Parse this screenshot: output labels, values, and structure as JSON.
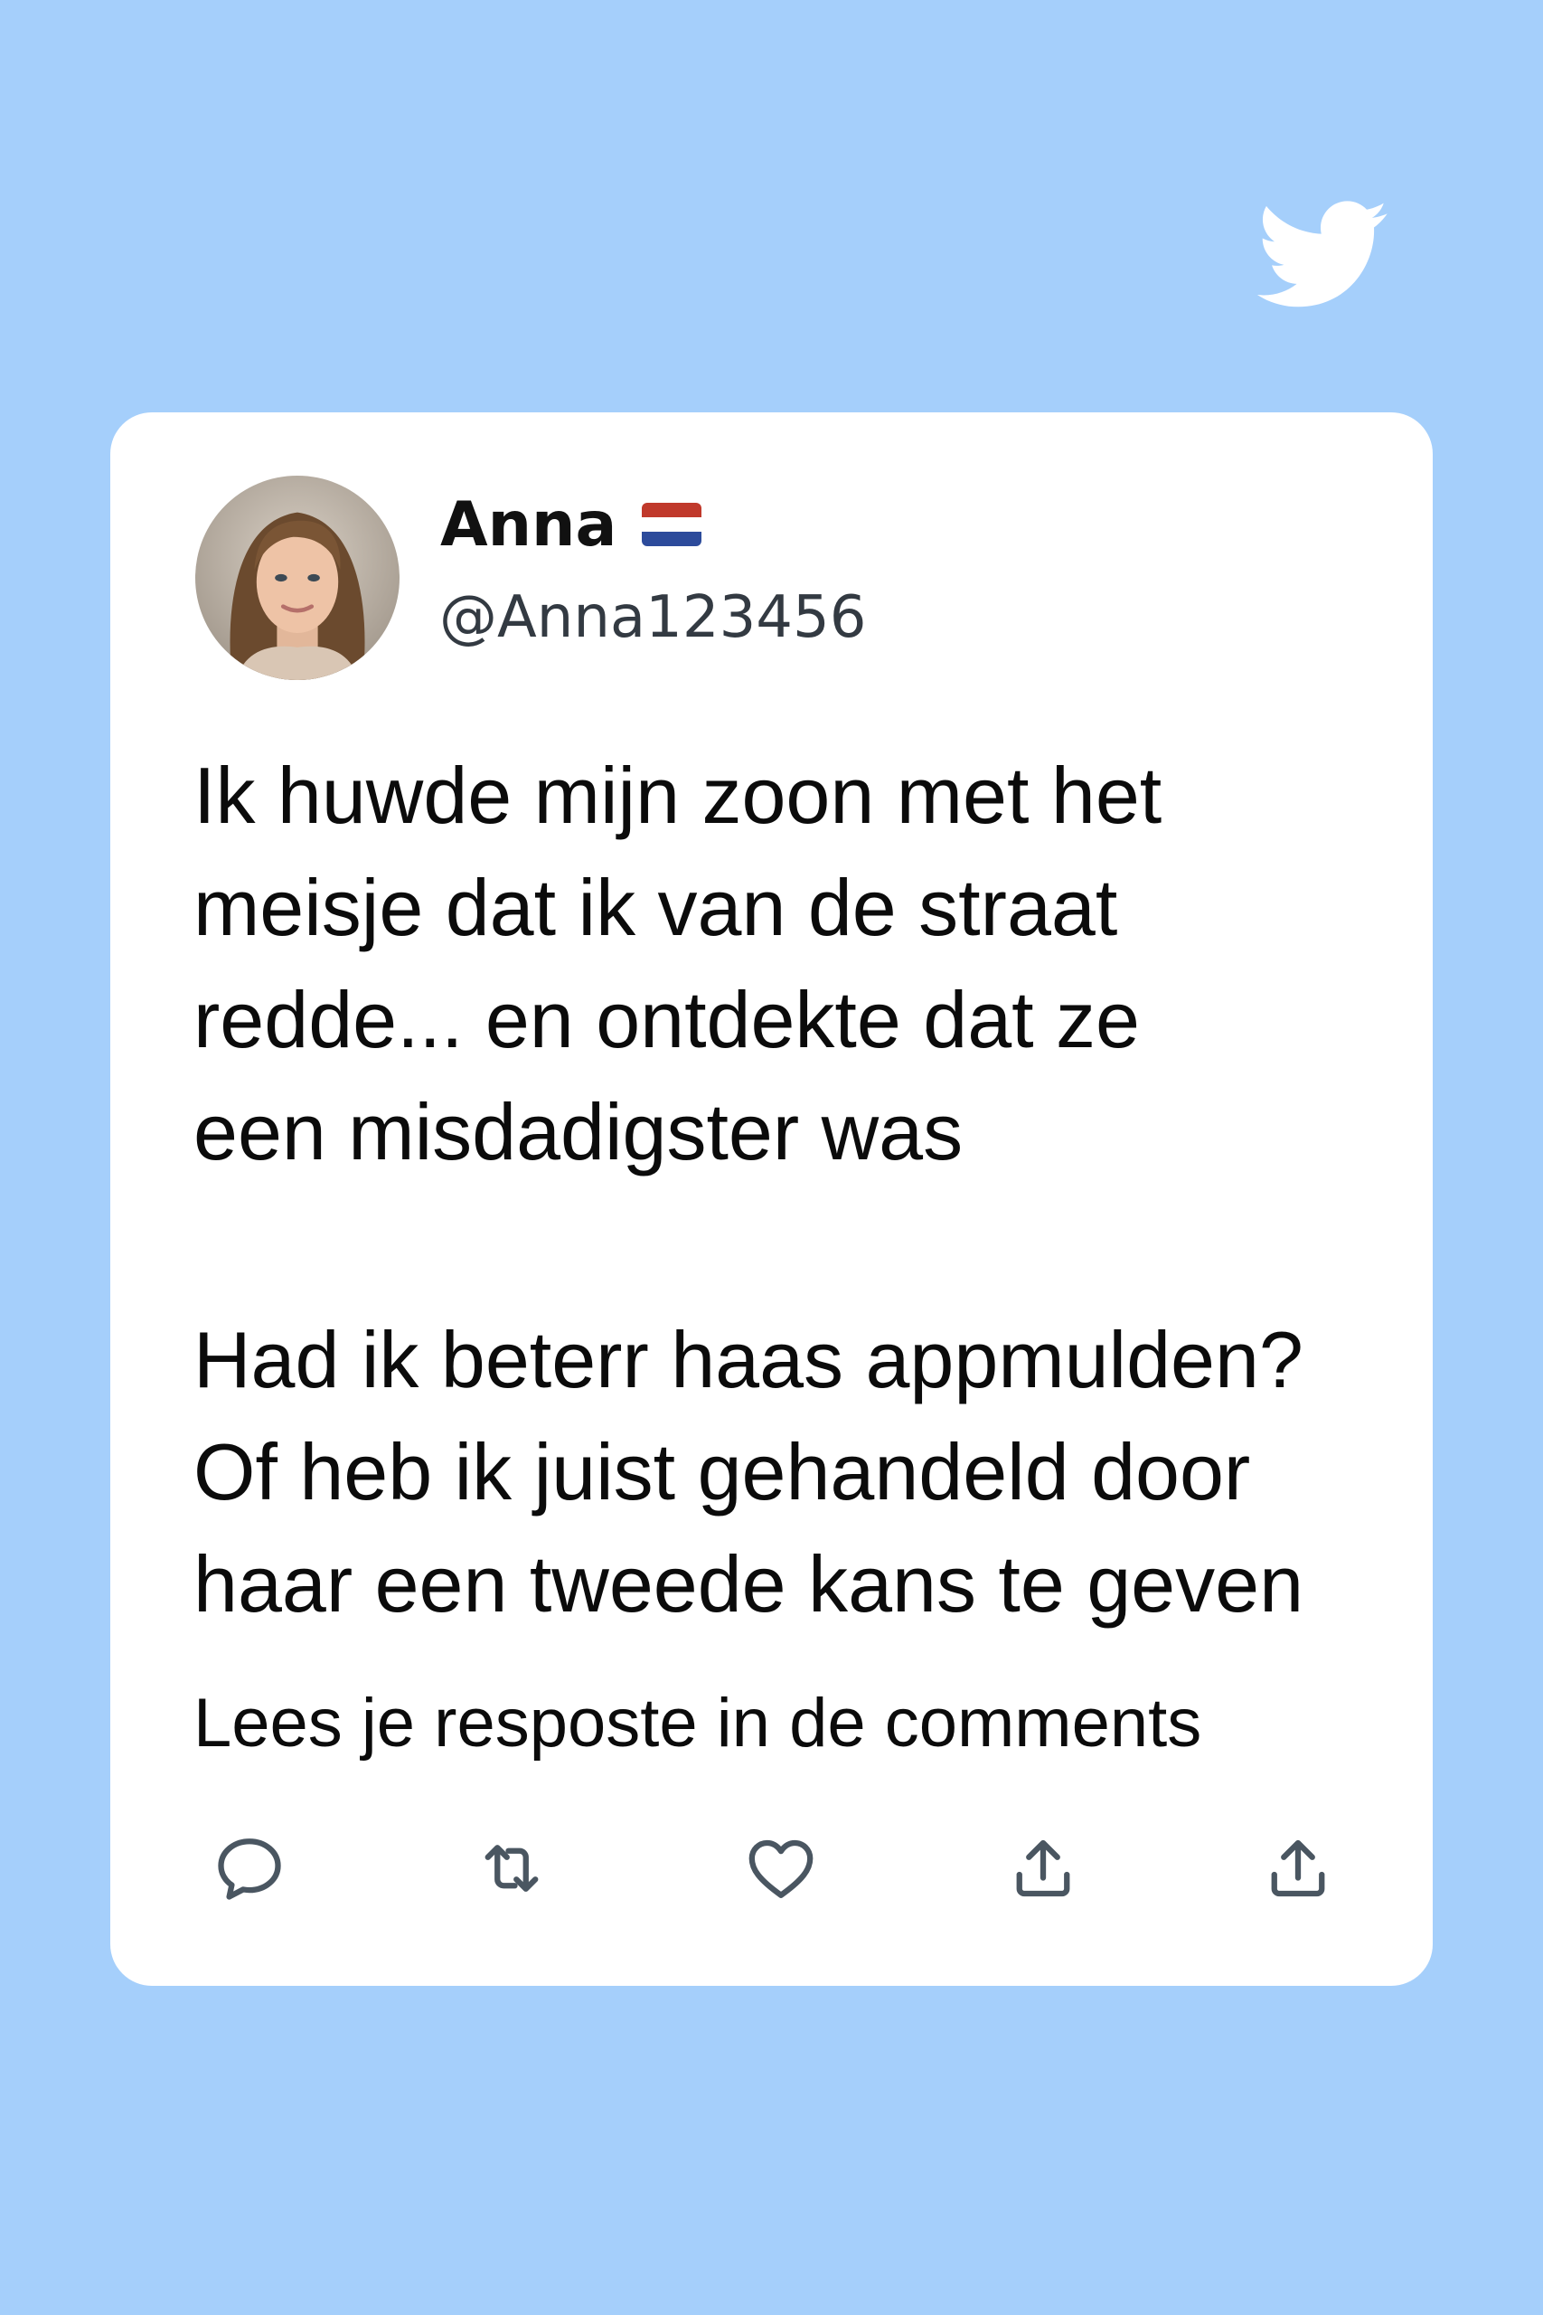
{
  "brand": {
    "logo_icon": "twitter-bird-icon",
    "background_color": "#a5cffb",
    "logo_color": "#ffffff"
  },
  "tweet": {
    "author": {
      "display_name": "Anna",
      "flag_icon": "netherlands-flag-icon",
      "handle": "@Anna123456",
      "avatar_icon": "user-avatar"
    },
    "body_paragraph_1": [
      "Ik huwde mijn zoon met het",
      "meisje dat ik van de straat",
      "redde... en ontdekte dat ze",
      "een misdadigster was"
    ],
    "body_paragraph_2": [
      "Had ik beterr haas appmulden?",
      "Of heb ik juist gehandeld door",
      "haar een tweede kans te geven"
    ],
    "call_to_action": "Lees je resposte in de comments"
  },
  "actions": [
    {
      "name": "reply",
      "icon": "comment-icon"
    },
    {
      "name": "retweet",
      "icon": "retweet-icon"
    },
    {
      "name": "like",
      "icon": "heart-icon"
    },
    {
      "name": "share",
      "icon": "share-icon"
    },
    {
      "name": "share",
      "icon": "share-icon"
    }
  ],
  "colors": {
    "card_background": "#ffffff",
    "text_primary": "#0b0b0b",
    "text_secondary": "#333a42",
    "icon_color": "#4a5661"
  }
}
